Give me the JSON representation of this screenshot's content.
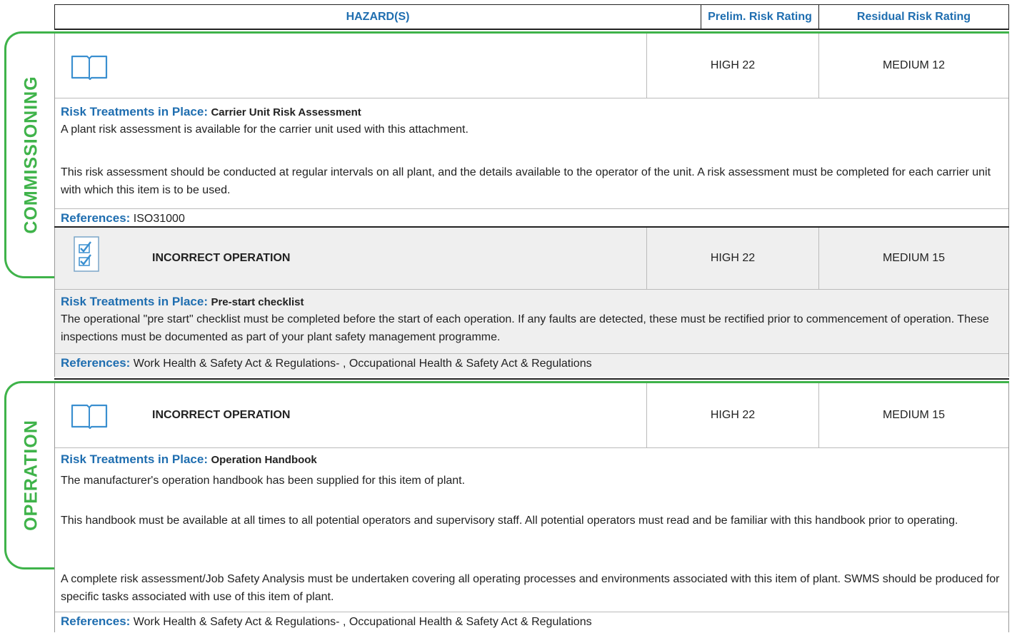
{
  "header": {
    "hazards": "HAZARD(S)",
    "prelim": "Prelim. Risk Rating",
    "residual": "Residual Risk Rating"
  },
  "sections": [
    {
      "label": "COMMISSIONING",
      "hazards": [
        {
          "icon": "book-icon",
          "name": "",
          "prelim": "HIGH 22",
          "residual": "MEDIUM 12",
          "treatment_label": "Risk Treatments in Place:",
          "treatment_title": "Carrier Unit Risk Assessment",
          "paragraphs": [
            "A plant risk assessment is available for the carrier unit used with this attachment.",
            "This risk assessment should be conducted at regular intervals on all plant, and the details available to the operator of the unit. A risk assessment must be completed for each carrier unit with which this item is to be used."
          ],
          "references_label": "References:",
          "references": "ISO31000"
        },
        {
          "icon": "checklist-icon",
          "name": "INCORRECT OPERATION",
          "prelim": "HIGH 22",
          "residual": "MEDIUM 15",
          "treatment_label": "Risk Treatments in Place:",
          "treatment_title": "Pre-start checklist",
          "paragraphs": [
            "The operational \"pre start\" checklist must be completed before the start of each operation. If any faults are detected, these must be rectified prior to commencement of operation. These inspections must be documented as part of your plant safety management programme."
          ],
          "references_label": "References:",
          "references": "Work Health & Safety Act & Regulations- , Occupational Health & Safety Act & Regulations"
        }
      ]
    },
    {
      "label": "OPERATION",
      "hazards": [
        {
          "icon": "book-icon",
          "name": "INCORRECT OPERATION",
          "prelim": "HIGH 22",
          "residual": "MEDIUM 15",
          "treatment_label": "Risk Treatments in Place:",
          "treatment_title": "Operation Handbook",
          "paragraphs": [
            "The manufacturer's operation handbook has been supplied for this item of plant.",
            "This handbook must be available at all times to all potential operators and supervisory staff. All potential operators must read and be familiar with this handbook prior to operating.",
            "A complete risk assessment/Job Safety Analysis must be undertaken covering all operating processes and environments associated with this item of plant. SWMS should be produced for specific tasks associated with use of this item of plant."
          ],
          "references_label": "References:",
          "references": "Work Health & Safety Act & Regulations- , Occupational Health & Safety Act & Regulations"
        }
      ]
    }
  ],
  "colors": {
    "section_green": "#3fb34a",
    "label_blue": "#1f6eb0",
    "gray_row": "#efefef"
  }
}
